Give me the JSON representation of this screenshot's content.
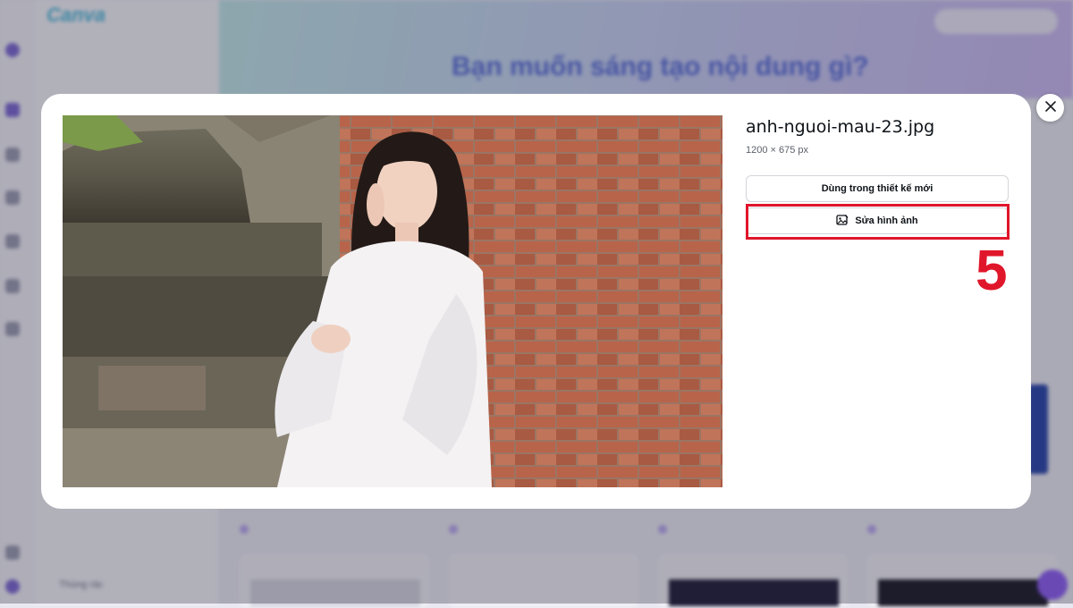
{
  "background": {
    "logo": "Canva",
    "hero_title": "Bạn muốn sáng tạo nội dung gì?",
    "trash_label": "Thùng rác"
  },
  "modal": {
    "file_name": "anh-nguoi-mau-23.jpg",
    "dimensions": "1200 × 675 px",
    "use_in_new_design_label": "Dùng trong thiết kế mới",
    "edit_image_label": "Sửa hình ảnh",
    "step_number": "5",
    "close_icon": "close-icon",
    "edit_icon": "image-edit-icon"
  },
  "colors": {
    "highlight": "#e0162b",
    "accent": "#7d2ae8"
  }
}
